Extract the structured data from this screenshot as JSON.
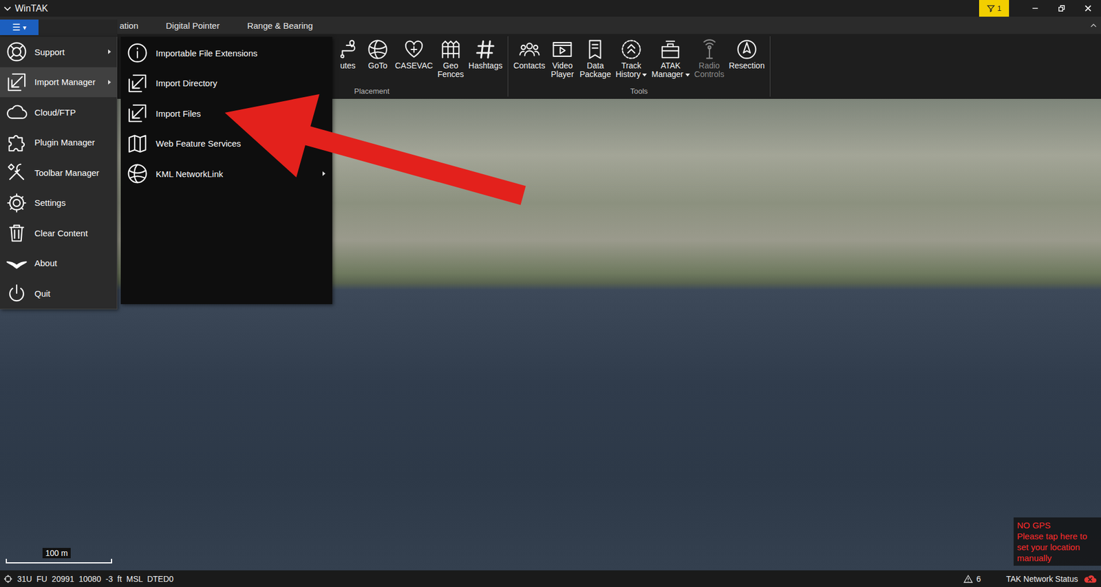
{
  "window": {
    "title": "WinTAK",
    "notification_count": "1"
  },
  "menu_button": {
    "label": "☰",
    "arrow": "▾"
  },
  "tabs": [
    {
      "label": "ation",
      "selected": false
    },
    {
      "label": "Digital Pointer",
      "selected": false
    },
    {
      "label": "Range & Bearing",
      "selected": false
    }
  ],
  "ribbon": {
    "groups": [
      {
        "label": "Placement",
        "items": [
          {
            "lines": [
              "utes"
            ],
            "dropdown": false,
            "disabled": false
          },
          {
            "lines": [
              "GoTo"
            ],
            "dropdown": false,
            "disabled": false
          },
          {
            "lines": [
              "CASEVAC"
            ],
            "dropdown": false,
            "disabled": false
          },
          {
            "lines": [
              "Geo",
              "Fences"
            ],
            "dropdown": false,
            "disabled": false
          },
          {
            "lines": [
              "Hashtags"
            ],
            "dropdown": false,
            "disabled": false
          }
        ]
      },
      {
        "label": "Tools",
        "items": [
          {
            "lines": [
              "Contacts"
            ],
            "dropdown": false,
            "disabled": false
          },
          {
            "lines": [
              "Video",
              "Player"
            ],
            "dropdown": false,
            "disabled": false
          },
          {
            "lines": [
              "Data",
              "Package"
            ],
            "dropdown": false,
            "disabled": false
          },
          {
            "lines": [
              "Track",
              "History"
            ],
            "dropdown": true,
            "disabled": false
          },
          {
            "lines": [
              "ATAK",
              "Manager"
            ],
            "dropdown": true,
            "disabled": false
          },
          {
            "lines": [
              "Radio",
              "Controls"
            ],
            "dropdown": false,
            "disabled": true
          },
          {
            "lines": [
              "Resection"
            ],
            "dropdown": false,
            "disabled": false
          }
        ]
      }
    ]
  },
  "main_menu": {
    "items": [
      {
        "label": "Support",
        "submenu": true,
        "selected": false
      },
      {
        "label": "Import Manager",
        "submenu": true,
        "selected": true
      },
      {
        "label": "Cloud/FTP",
        "submenu": false,
        "selected": false
      },
      {
        "label": "Plugin Manager",
        "submenu": false,
        "selected": false
      },
      {
        "label": "Toolbar Manager",
        "submenu": false,
        "selected": false
      },
      {
        "label": "Settings",
        "submenu": false,
        "selected": false
      },
      {
        "label": "Clear Content",
        "submenu": false,
        "selected": false
      },
      {
        "label": "About",
        "submenu": false,
        "selected": false
      },
      {
        "label": "Quit",
        "submenu": false,
        "selected": false
      }
    ]
  },
  "submenu": {
    "items": [
      {
        "label": "Importable File Extensions",
        "submenu": false,
        "selected": false
      },
      {
        "label": "Import Directory",
        "submenu": false,
        "selected": false
      },
      {
        "label": "Import Files",
        "submenu": false,
        "selected": false
      },
      {
        "label": "Web Feature Services",
        "submenu": false,
        "selected": false
      },
      {
        "label": "KML NetworkLink",
        "submenu": true,
        "selected": false
      }
    ]
  },
  "map": {
    "scale": "100 m",
    "gps_warning": [
      "NO GPS",
      "Please tap here to",
      "set your location",
      "manually"
    ]
  },
  "status_bar": {
    "coordinates": "31U FU 20991 10080 -3 ft MSL DTED0",
    "alert_count": "6",
    "network": "TAK Network Status"
  }
}
